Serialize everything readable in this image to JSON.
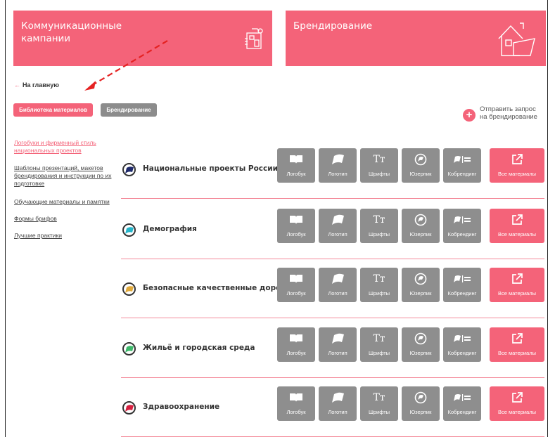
{
  "banners": {
    "left_title": "Коммуникационные кампании",
    "right_title": "Брендирование"
  },
  "nav": {
    "back_link": "На главную",
    "back_icon": "arrow-left-icon",
    "tab_library": "Библиотека материалов",
    "tab_branding": "Брендирование"
  },
  "request": {
    "line1": "Отправить запрос",
    "line2": "на брендирование"
  },
  "sidebar": {
    "items": [
      {
        "label": "Логобуки и фирменный стиль национальных проектов",
        "active": true
      },
      {
        "label": "Шаблоны презентаций, макетов брендирования и инструкции по их подготовке",
        "active": false
      },
      {
        "label": "Обучающие материалы и памятки",
        "active": false
      },
      {
        "label": "Формы брифов",
        "active": false
      },
      {
        "label": "Лучшие практики",
        "active": false
      }
    ]
  },
  "buttons": {
    "logobook": "Логобук",
    "logo": "Логотип",
    "fonts": "Шрифты",
    "userpic": "Юзерпик",
    "cobranding": "Кобрендинг",
    "all": "Все материалы",
    "fonts_glyph": "Tт"
  },
  "projects": [
    {
      "title": "Национальные проекты России",
      "color": "#1f2a6b"
    },
    {
      "title": "Демография",
      "color": "#27b5c9"
    },
    {
      "title": "Безопасные качественные дороги",
      "color": "#e0a93a"
    },
    {
      "title": "Жильё и городская среда",
      "color": "#3db86a"
    },
    {
      "title": "Здравоохранение",
      "color": "#d6203f"
    }
  ],
  "colors": {
    "accent": "#f46379",
    "gray_button": "#8e8e8e",
    "annotation_arrow": "#e52222"
  }
}
